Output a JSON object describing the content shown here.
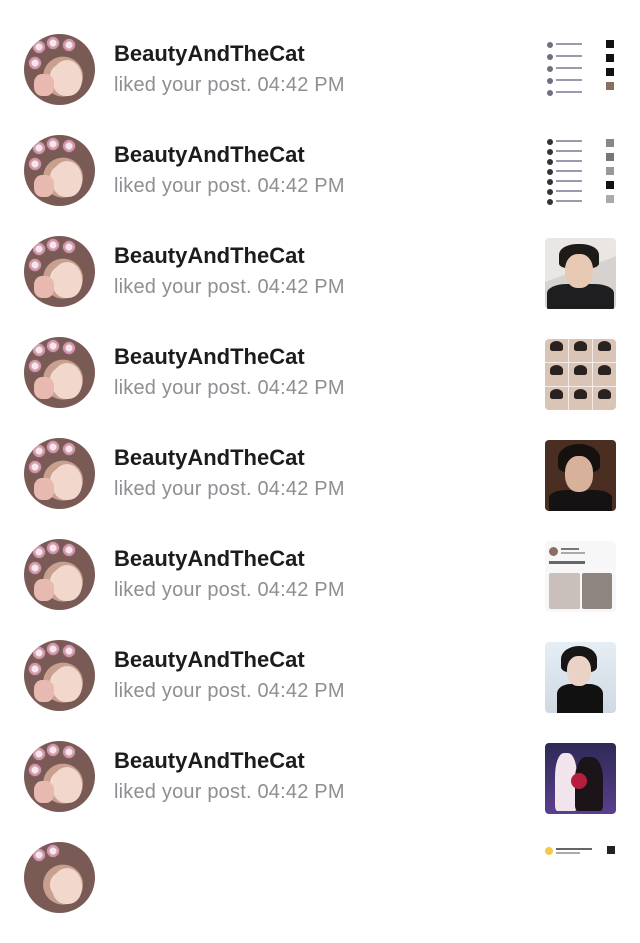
{
  "notifications": [
    {
      "username": "",
      "action": "",
      "thumb": "dark-post"
    },
    {
      "username": "BeautyAndTheCat",
      "action": "liked your post. 04:42 PM",
      "thumb": "list-screenshot"
    },
    {
      "username": "BeautyAndTheCat",
      "action": "liked your post. 04:42 PM",
      "thumb": "list-screenshot"
    },
    {
      "username": "BeautyAndTheCat",
      "action": "liked your post. 04:42 PM",
      "thumb": "portrait-photo"
    },
    {
      "username": "BeautyAndTheCat",
      "action": "liked your post. 04:42 PM",
      "thumb": "photo-grid"
    },
    {
      "username": "BeautyAndTheCat",
      "action": "liked your post. 04:42 PM",
      "thumb": "portrait-photo"
    },
    {
      "username": "BeautyAndTheCat",
      "action": "liked your post. 04:42 PM",
      "thumb": "tweet-screenshot"
    },
    {
      "username": "BeautyAndTheCat",
      "action": "liked your post. 04:42 PM",
      "thumb": "portrait-photo"
    },
    {
      "username": "BeautyAndTheCat",
      "action": "liked your post. 04:42 PM",
      "thumb": "stage-photo"
    },
    {
      "username": "",
      "action": "",
      "thumb": "notification-screenshot"
    }
  ]
}
